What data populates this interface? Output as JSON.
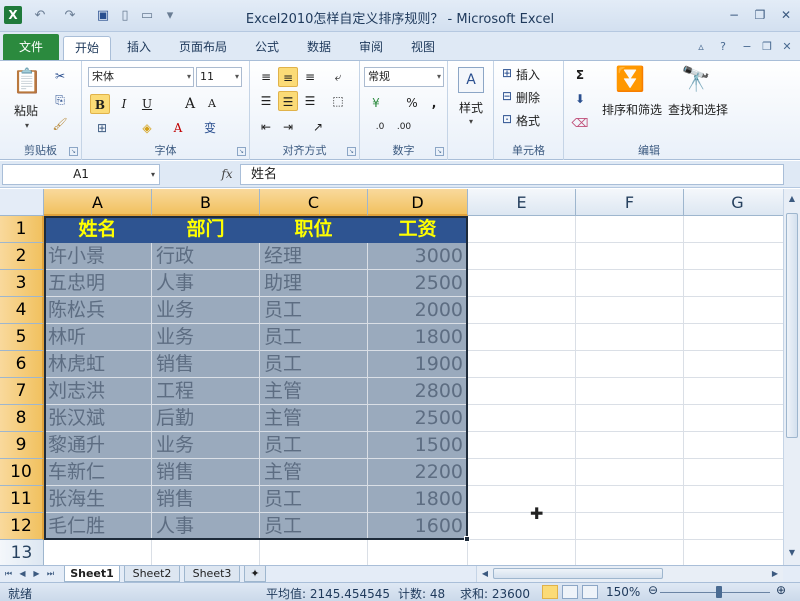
{
  "window": {
    "title": "Excel2010怎样自定义排序规则？ - Microsoft Excel",
    "logo": "X"
  },
  "ribbon_tabs": {
    "file": "文件",
    "items": [
      "开始",
      "插入",
      "页面布局",
      "公式",
      "数据",
      "审阅",
      "视图"
    ],
    "active": "开始"
  },
  "ribbon": {
    "clipboard": {
      "paste": "粘贴",
      "label": "剪贴板"
    },
    "font": {
      "name": "宋体",
      "size": "11",
      "bold": "B",
      "italic": "I",
      "underline": "U",
      "grow": "A",
      "shrink": "A",
      "color": "A",
      "wen": "变",
      "label": "字体"
    },
    "alignment": {
      "label": "对齐方式"
    },
    "number": {
      "format": "常规",
      "percent": "%",
      "comma": ",",
      "label": "数字"
    },
    "styles": {
      "label": "样式"
    },
    "cells": {
      "insert": "插入",
      "delete": "删除",
      "format": "格式",
      "label": "单元格"
    },
    "editing": {
      "sort_filter": "排序和筛选",
      "find_select": "查找和选择",
      "label": "编辑"
    }
  },
  "formula_bar": {
    "name_box": "A1",
    "fx": "fx",
    "content": "姓名"
  },
  "sheet": {
    "columns": [
      "A",
      "B",
      "C",
      "D",
      "E",
      "F",
      "G"
    ],
    "rows": [
      "1",
      "2",
      "3",
      "4",
      "5",
      "6",
      "7",
      "8",
      "9",
      "10",
      "11",
      "12",
      "13"
    ],
    "header": [
      "姓名",
      "部门",
      "职位",
      "工资"
    ],
    "data": [
      [
        "许小景",
        "行政",
        "经理",
        "3000"
      ],
      [
        "五忠明",
        "人事",
        "助理",
        "2500"
      ],
      [
        "陈松兵",
        "业务",
        "员工",
        "2000"
      ],
      [
        "林听",
        "业务",
        "员工",
        "1800"
      ],
      [
        "林虎虹",
        "销售",
        "员工",
        "1900"
      ],
      [
        "刘志洪",
        "工程",
        "主管",
        "2800"
      ],
      [
        "张汉斌",
        "后勤",
        "主管",
        "2500"
      ],
      [
        "黎通升",
        "业务",
        "员工",
        "1500"
      ],
      [
        "车新仁",
        "销售",
        "主管",
        "2200"
      ],
      [
        "张海生",
        "销售",
        "员工",
        "1800"
      ],
      [
        "毛仁胜",
        "人事",
        "员工",
        "1600"
      ]
    ],
    "colors": {
      "header_bg": "#2e5491",
      "header_text": "#ffff00",
      "data_bg": "#9aaabd",
      "data_text": "#5d6d82"
    }
  },
  "sheet_tabs": [
    "Sheet1",
    "Sheet2",
    "Sheet3"
  ],
  "status": {
    "mode": "就绪",
    "average": "平均值: 2145.454545",
    "count": "计数: 48",
    "sum": "求和: 23600",
    "zoom": "150%"
  }
}
